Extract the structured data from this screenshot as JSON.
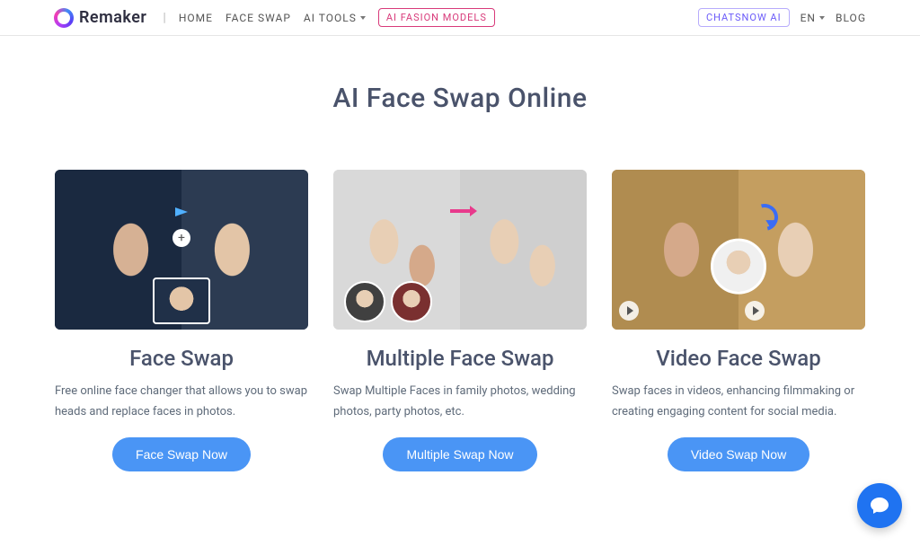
{
  "brand": "Remaker",
  "nav": {
    "home": "HOME",
    "faceswap": "FACE SWAP",
    "aitools": "AI TOOLS",
    "fashion": "AI FASION MODELS"
  },
  "header_right": {
    "chatsnow": "CHATSNOW AI",
    "lang": "EN",
    "blog": "BLOG"
  },
  "page_title": "AI Face Swap Online",
  "cards": [
    {
      "title": "Face Swap",
      "desc": "Free online face changer that allows you to swap heads and replace faces in photos.",
      "cta": "Face Swap Now"
    },
    {
      "title": "Multiple Face Swap",
      "desc": "Swap Multiple Faces in family photos, wedding photos, party photos, etc.",
      "cta": "Multiple Swap Now"
    },
    {
      "title": "Video Face Swap",
      "desc": "Swap faces in videos, enhancing filmmaking or creating engaging content for social media.",
      "cta": "Video Swap Now"
    }
  ]
}
